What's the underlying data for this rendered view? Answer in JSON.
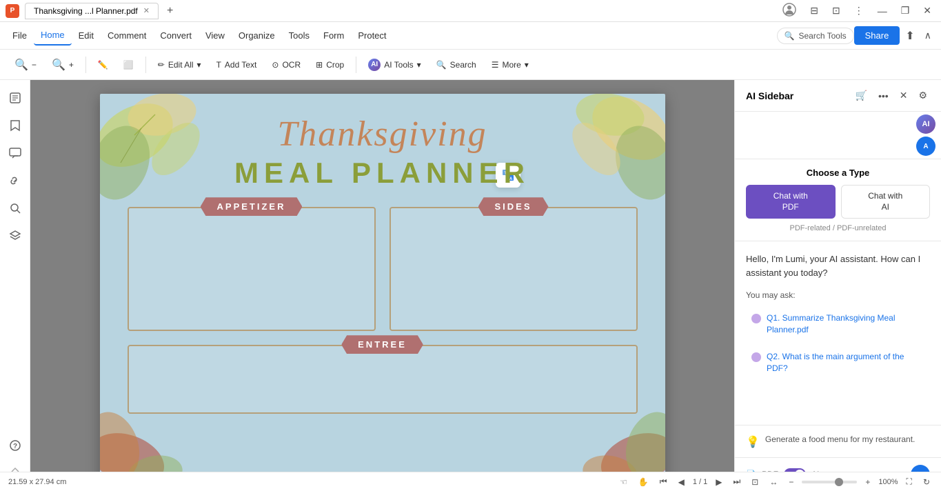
{
  "titleBar": {
    "tabTitle": "Thanksgiving ...l Planner.pdf",
    "windowControls": [
      "minimize",
      "maximize",
      "close"
    ]
  },
  "menuBar": {
    "items": [
      {
        "id": "file",
        "label": "File"
      },
      {
        "id": "edit",
        "label": "Edit"
      },
      {
        "id": "comment",
        "label": "Comment"
      },
      {
        "id": "convert",
        "label": "Convert"
      },
      {
        "id": "view",
        "label": "View"
      },
      {
        "id": "organize",
        "label": "Organize"
      },
      {
        "id": "tools",
        "label": "Tools"
      },
      {
        "id": "form",
        "label": "Form"
      },
      {
        "id": "protect",
        "label": "Protect"
      }
    ],
    "activeItem": "home",
    "homeLabel": "Home",
    "searchToolsPlaceholder": "Search Tools",
    "shareLabel": "Share"
  },
  "toolbar": {
    "zoomOut": "−",
    "zoomIn": "+",
    "highlight": "✏",
    "editAll": "Edit All",
    "addText": "Add Text",
    "ocr": "OCR",
    "crop": "Crop",
    "aiTools": "AI Tools",
    "search": "Search",
    "more": "More"
  },
  "leftSidebar": {
    "icons": [
      {
        "id": "pages",
        "symbol": "⊞",
        "label": "Pages"
      },
      {
        "id": "bookmarks",
        "symbol": "🔖",
        "label": "Bookmarks"
      },
      {
        "id": "comments",
        "symbol": "💬",
        "label": "Comments"
      },
      {
        "id": "links",
        "symbol": "🔗",
        "label": "Links"
      },
      {
        "id": "search",
        "symbol": "🔍",
        "label": "Search"
      },
      {
        "id": "layers",
        "symbol": "⧉",
        "label": "Layers"
      }
    ],
    "bottomIcon": {
      "id": "help",
      "symbol": "?",
      "label": "Help"
    }
  },
  "pdf": {
    "title1": "Thanksgiving",
    "title2": "MEAL PLANNER",
    "sections": [
      {
        "id": "appetizer",
        "label": "APPETIZER"
      },
      {
        "id": "sides",
        "label": "SIDES"
      },
      {
        "id": "entree",
        "label": "ENTREE"
      }
    ]
  },
  "aiSidebar": {
    "title": "AI Sidebar",
    "chooseTypeLabel": "Choose a Type",
    "chatWithPDF": "Chat with\nPDF",
    "chatWithAI": "Chat with\nAI",
    "subtitleLabel": "PDF-related / PDF-unrelated",
    "greeting": "Hello, I'm Lumi, your AI assistant. How can I assistant you today?",
    "suggestionsTitle": "You may ask:",
    "suggestions": [
      {
        "id": "q1",
        "text": "Q1. Summarize Thanksgiving Meal Planner.pdf"
      },
      {
        "id": "q2",
        "text": "Q2. What is the main argument of the PDF?"
      }
    ],
    "promptText": "Generate a food menu for my restaurant.",
    "footer": {
      "pdfLabel": "PDF",
      "aiLabel": "AI",
      "toggleOn": true
    }
  },
  "statusBar": {
    "dimensions": "21.59 x 27.94 cm",
    "pageInfo": "1 / 1",
    "zoomLevel": "100%"
  }
}
